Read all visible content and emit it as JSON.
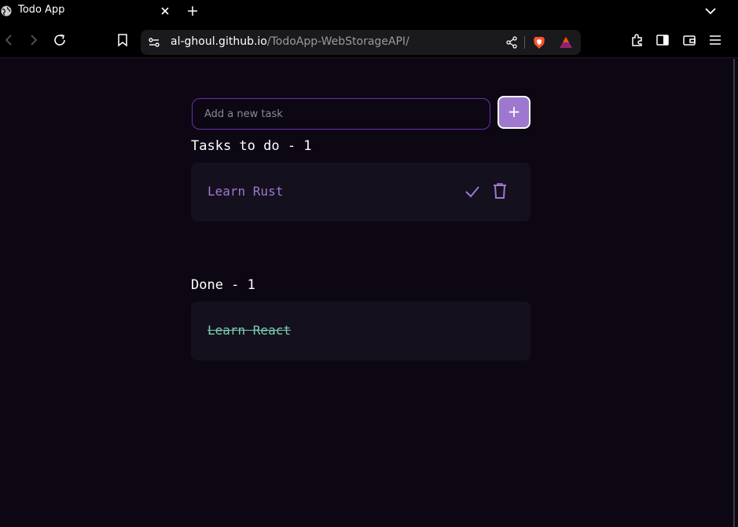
{
  "browser": {
    "tab_title": "Todo App",
    "url_host": "al-ghoul.github.io",
    "url_path": "/TodoApp-WebStorageAPI/"
  },
  "app": {
    "input_placeholder": "Add a new task",
    "input_value": "",
    "add_button_label": "+",
    "todo_section_title": "Tasks to do - 1",
    "done_section_title": "Done - 1",
    "todo_tasks": [
      {
        "text": "Learn Rust"
      }
    ],
    "done_tasks": [
      {
        "text": "Learn React"
      }
    ]
  },
  "colors": {
    "background": "#0d0714",
    "card": "#15101d",
    "accent": "#9e78cf",
    "done": "#78cfb0",
    "input_border": "#6b2fb0"
  },
  "icons": {
    "tab": "globe-icon",
    "tab_close": "close-icon",
    "new_tab": "plus-icon",
    "tab_list": "chevron-down-icon",
    "back": "back-icon",
    "forward": "forward-icon",
    "reload": "reload-icon",
    "bookmark": "bookmark-icon",
    "site_info": "site-settings-icon",
    "share": "share-icon",
    "brave_shields": "brave-lion-icon",
    "brave_rewards": "bat-triangle-icon",
    "extensions": "puzzle-icon",
    "sidebar": "sidebar-icon",
    "wallet": "wallet-icon",
    "menu": "hamburger-menu-icon",
    "task_complete": "check-icon",
    "task_delete": "trash-icon"
  }
}
